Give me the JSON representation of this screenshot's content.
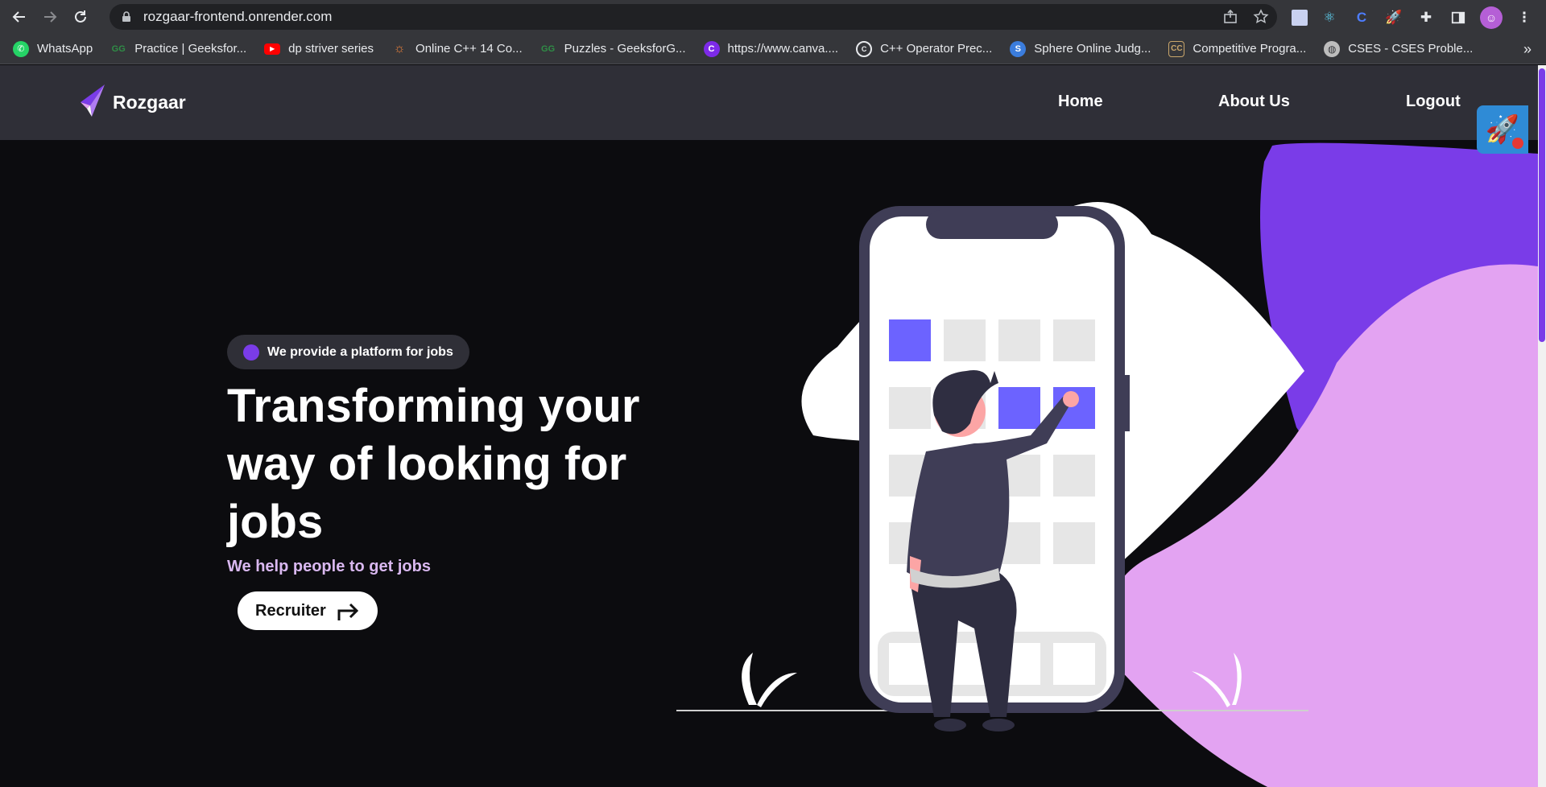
{
  "browser": {
    "url": "rozgaar-frontend.onrender.com",
    "bookmarks": [
      {
        "label": "WhatsApp",
        "icon": "whatsapp-icon",
        "color": "#25d366"
      },
      {
        "label": "Practice | Geeksfor...",
        "icon": "geeksforgeeks-icon",
        "color": "#2f8d46"
      },
      {
        "label": "dp striver series",
        "icon": "youtube-icon",
        "color": "#ff0000"
      },
      {
        "label": "Online C++ 14 Co...",
        "icon": "sun-icon",
        "color": "#e8803a"
      },
      {
        "label": "Puzzles - GeeksforG...",
        "icon": "geeksforgeeks-icon",
        "color": "#2f8d46"
      },
      {
        "label": "https://www.canva....",
        "icon": "canva-icon",
        "color": "#7d2ae8"
      },
      {
        "label": "C++ Operator Prec...",
        "icon": "cppreference-icon",
        "color": "#ffffff"
      },
      {
        "label": "Sphere Online Judg...",
        "icon": "spoj-icon",
        "color": "#3b7ddd"
      },
      {
        "label": "Competitive Progra...",
        "icon": "cc-icon",
        "color": "#c9a66b"
      },
      {
        "label": "CSES - CSES Proble...",
        "icon": "globe-icon",
        "color": "#bdbdbd"
      }
    ],
    "more": "»"
  },
  "site": {
    "brand": "Rozgaar",
    "nav": {
      "home": "Home",
      "about": "About Us",
      "logout": "Logout"
    },
    "badge": "We provide a platform for jobs",
    "headline": "Transforming your way of looking for jobs",
    "subline": "We help people to get jobs",
    "cta": "Recruiter"
  },
  "colors": {
    "accent_purple": "#7a3ce8",
    "blob_pink": "#e3a3f2",
    "tile_blue": "#6c63ff",
    "nav_bg": "#2f2f37",
    "page_bg": "#0c0c0f"
  }
}
